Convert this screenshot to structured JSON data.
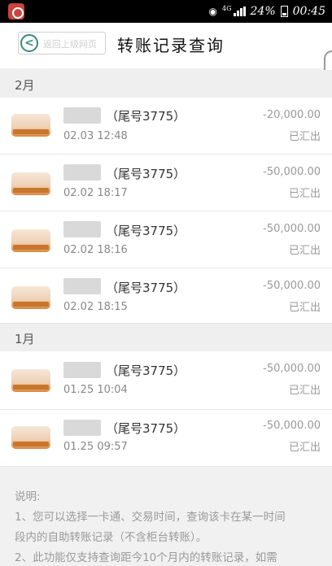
{
  "status_bar": {
    "network": "4G",
    "battery": "24%",
    "time": "00:45"
  },
  "header": {
    "back_label": "返回上级网页",
    "title": "转账记录查询"
  },
  "months": [
    {
      "label": "2月",
      "records": [
        {
          "account": "（尾号3775）",
          "datetime": "02.03 12:48",
          "amount": "-20,000.00",
          "status": "已汇出"
        },
        {
          "account": "（尾号3775）",
          "datetime": "02.02 18:17",
          "amount": "-50,000.00",
          "status": "已汇出"
        },
        {
          "account": "（尾号3775）",
          "datetime": "02.02 18:16",
          "amount": "-50,000.00",
          "status": "已汇出"
        },
        {
          "account": "（尾号3775）",
          "datetime": "02.02 18:15",
          "amount": "-50,000.00",
          "status": "已汇出"
        }
      ]
    },
    {
      "label": "1月",
      "records": [
        {
          "account": "（尾号3775）",
          "datetime": "01.25 10:04",
          "amount": "-50,000.00",
          "status": "已汇出"
        },
        {
          "account": "（尾号3775）",
          "datetime": "01.25 09:57",
          "amount": "-50,000.00",
          "status": "已汇出"
        }
      ]
    }
  ],
  "notes": {
    "title": "说明:",
    "line1": "1、您可以选择一卡通、交易时间，查询该卡在某一时间",
    "line2": "段内的自助转账记录（不含柜台转账）。",
    "line3": "2、此功能仅支持查询距今10个月内的转账记录，如需"
  }
}
